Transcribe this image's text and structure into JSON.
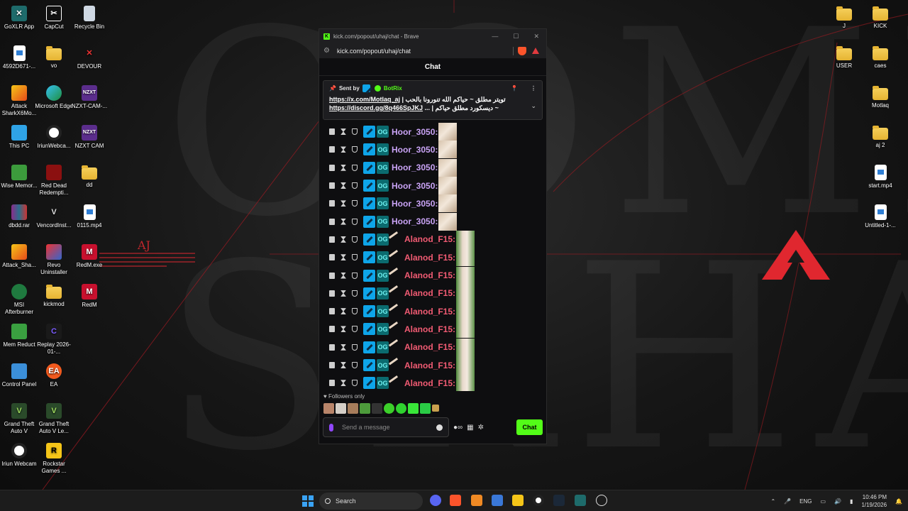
{
  "desktop_icons": {
    "goxlr": "GoXLR App",
    "capcut": "CapCut",
    "recycle": "Recycle Bin",
    "file4592": "4592D671-...",
    "vo": "vo",
    "devour": "DEVOUR",
    "attack_shark": "Attack SharkX6Mo...",
    "edge": "Microsoft Edge",
    "nzxt_cam_dots": "NZXT-CAM-...",
    "this_pc": "This PC",
    "iriun_webca": "IriunWebca...",
    "nzxt_cam": "NZXT CAM",
    "wise": "Wise Memor...",
    "rdr": "Red Dead Redempti...",
    "dd": "dd",
    "dbdd": "dbdd.rar",
    "vencord": "VencordInst...",
    "mp4_0115": "0115.mp4",
    "attack_sha": "Attack_Sha...",
    "revo": "Revo Uninstaller",
    "redm_exe": "RedM.exe",
    "msi": "MSI Afterburner",
    "kickmod": "kickmod",
    "redm": "RedM",
    "memreduct": "Mem Reduct",
    "replay": "Replay 2026-01-...",
    "control_panel": "Control Panel",
    "ea": "EA",
    "gta": "Grand Theft Auto V",
    "gta_le": "Grand Theft Auto V Le...",
    "iriun": "Iriun Webcam",
    "rockstar": "Rockstar Games ...",
    "j": "J",
    "kick": "KICK",
    "user": "USER",
    "caes": "caes",
    "motlaq": "Motlaq",
    "aj2": "aj 2",
    "start_mp4": "start.mp4",
    "untitled": "Untitled-1-..."
  },
  "wallpaper": {
    "letters": "COME SRHA",
    "aj_logo": "AJ",
    "accent": "#c0272d"
  },
  "browser": {
    "title": "kick.com/popout/uhaj/chat - Brave",
    "url": "kick.com/popout/uhaj/chat",
    "min": "—",
    "max": "☐",
    "close": "✕"
  },
  "chat": {
    "header": "Chat",
    "pinned": {
      "sent_by": "Sent by",
      "bot_name": "BotRix",
      "line1_link": "https://x.com/Motlaq_aj",
      "line1_text": "تويتر مطلق ~ حياكم الله تنورونا بالحب |",
      "line2_link": "https://discord.gg/8q466SpJKJ",
      "line2_text": "~ ديسكورد مطلق حياكم | ..."
    },
    "messages": [
      {
        "user": "Hoor_3050:",
        "style": "hoor"
      },
      {
        "user": "Hoor_3050:",
        "style": "hoor"
      },
      {
        "user": "Hoor_3050:",
        "style": "hoor"
      },
      {
        "user": "Hoor_3050:",
        "style": "hoor"
      },
      {
        "user": "Hoor_3050:",
        "style": "hoor"
      },
      {
        "user": "Hoor_3050:",
        "style": "hoor"
      },
      {
        "user": "Alanod_F15:",
        "style": "alanod"
      },
      {
        "user": "Alanod_F15:",
        "style": "alanod"
      },
      {
        "user": "Alanod_F15:",
        "style": "alanod"
      },
      {
        "user": "Alanod_F15:",
        "style": "alanod"
      },
      {
        "user": "Alanod_F15:",
        "style": "alanod"
      },
      {
        "user": "Alanod_F15:",
        "style": "alanod"
      },
      {
        "user": "Alanod_F15:",
        "style": "alanod"
      },
      {
        "user": "Alanod_F15:",
        "style": "alanod"
      },
      {
        "user": "Alanod_F15:",
        "style": "alanod"
      }
    ],
    "og_badge": "OG",
    "followers_only": "Followers only",
    "input_placeholder": "Send a message",
    "chat_button": "Chat",
    "kick_color": "#53fc18"
  },
  "taskbar": {
    "search": "Search",
    "lang": "ENG",
    "time": "10:46 PM",
    "date": "1/19/2026"
  }
}
